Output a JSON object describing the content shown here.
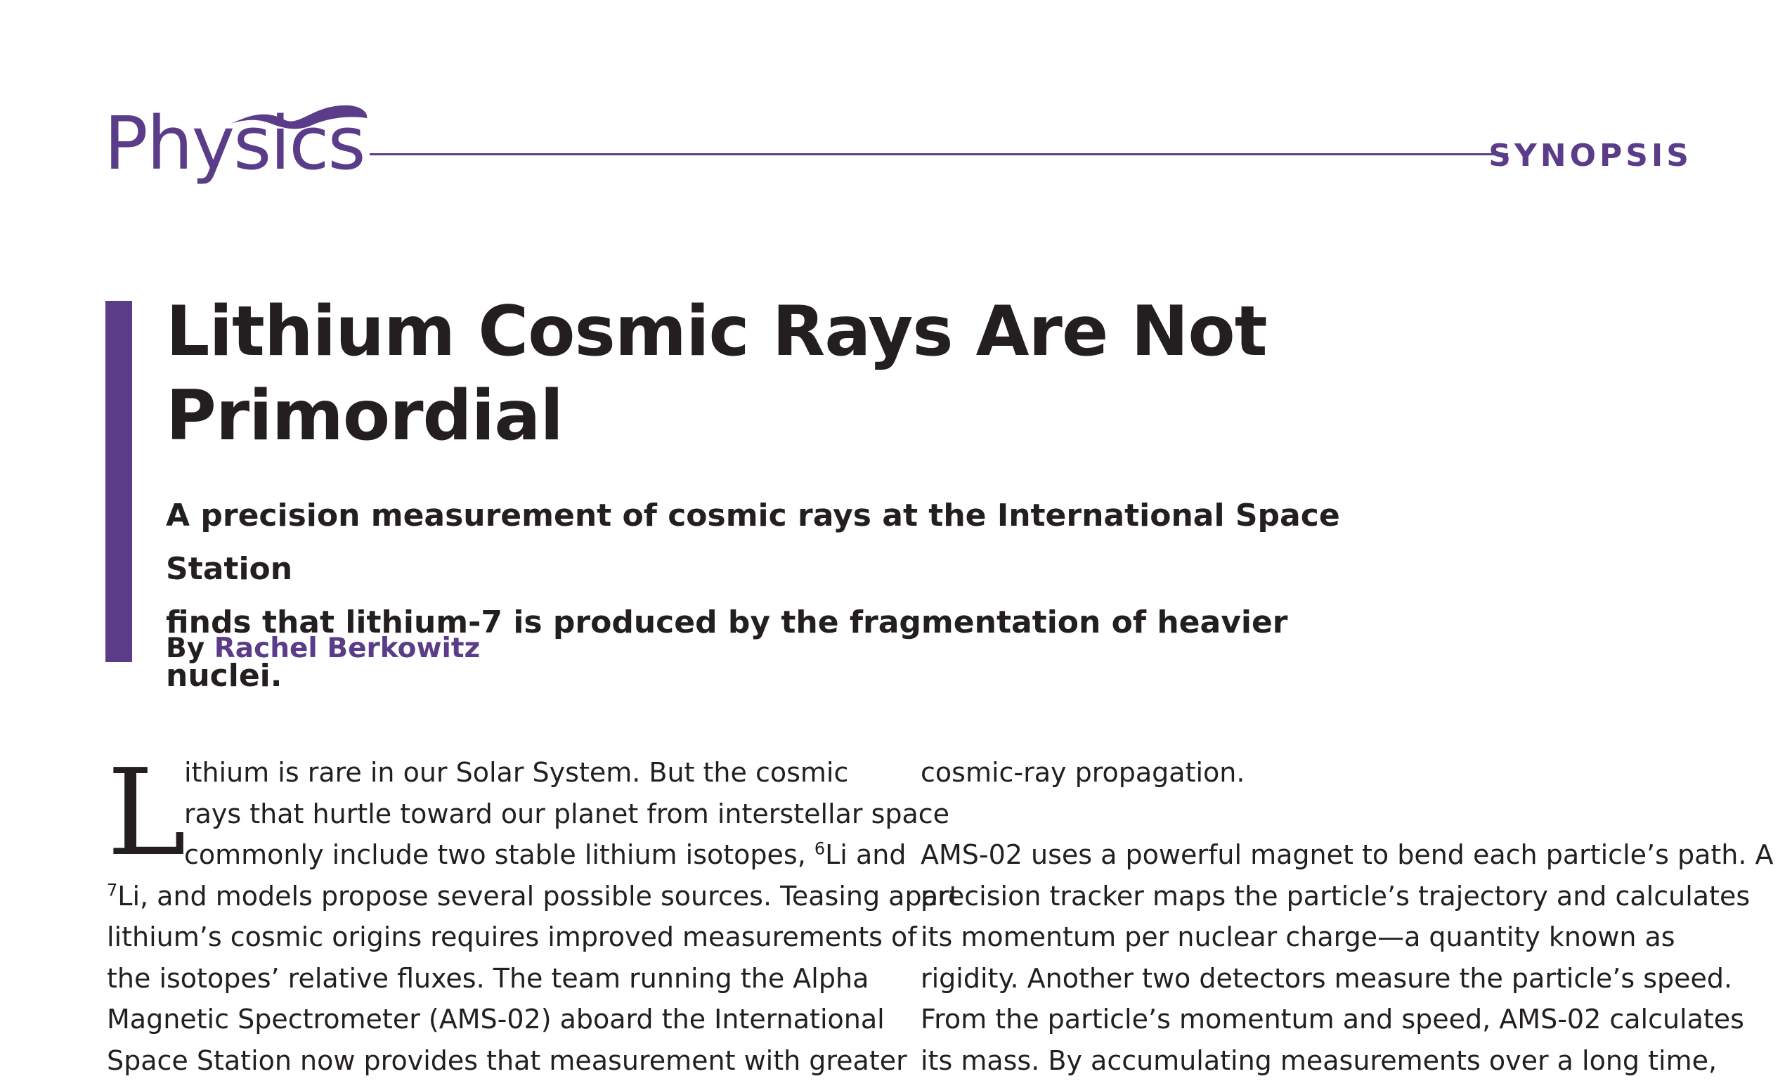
{
  "header": {
    "logo_text": "Physics",
    "section_label": "SYNOPSIS",
    "brand_color": "#5b3c88"
  },
  "article": {
    "title_line1": "Lithium Cosmic Rays Are Not",
    "title_line2": "Primordial",
    "subtitle_line1": "A precision measurement of cosmic rays at the International Space Station",
    "subtitle_line2": "finds that lithium-7 is produced by the fragmentation of heavier nuclei.",
    "byline_prefix": "By",
    "author": "Rachel Berkowitz"
  },
  "body": {
    "dropcap": "L",
    "left": {
      "l1": "ithium is rare in our Solar System. But the cosmic",
      "l2": "rays that hurtle toward our planet from interstellar space",
      "l3a": "commonly include two stable lithium isotopes, ",
      "l3_sup": "6",
      "l3b": "Li and",
      "l4_sup": "7",
      "l4b": "Li, and models propose several possible sources.  Teasing apart",
      "l5": "lithium’s cosmic origins requires improved measurements of",
      "l6": "the isotopes’ relative fluxes. The team running the Alpha",
      "l7": "Magnetic Spectrometer (AMS-02) aboard the International",
      "l8": "Space Station now provides that measurement with greater"
    },
    "right": {
      "l1": "cosmic-ray propagation.",
      "l2": "AMS-02 uses a powerful magnet to bend each particle’s path. A",
      "l3": "precision tracker maps the particle’s trajectory and calculates",
      "l4": "its momentum per nuclear charge—a quantity known as",
      "l5": "rigidity. Another two detectors measure the particle’s speed.",
      "l6": "From the particle’s momentum and speed, AMS-02 calculates",
      "l7": "its mass. By accumulating measurements over a long time,"
    }
  }
}
